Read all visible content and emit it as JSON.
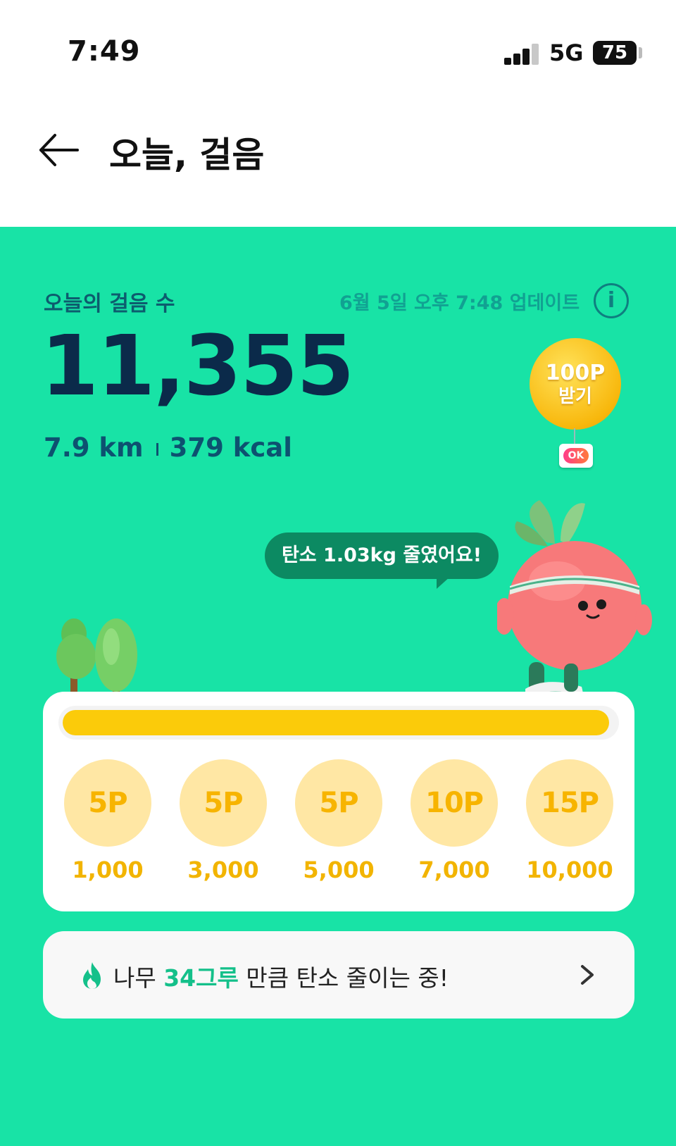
{
  "status_bar": {
    "time": "7:49",
    "network": "5G",
    "battery": "75"
  },
  "header": {
    "title": "오늘, 걸음"
  },
  "steps": {
    "label": "오늘의 걸음 수",
    "updated": "6월 5일 오후 7:48 업데이트",
    "count": "11,355",
    "distance": "7.9 km",
    "calories": "379 kcal"
  },
  "reward": {
    "points": "100P",
    "action": "받기",
    "brand": "OK"
  },
  "speech": {
    "text": "탄소 1.03kg 줄였어요!"
  },
  "progress": {
    "fraction": 0.99,
    "milestones": [
      {
        "points": "5P",
        "steps": "1,000"
      },
      {
        "points": "5P",
        "steps": "3,000"
      },
      {
        "points": "5P",
        "steps": "5,000"
      },
      {
        "points": "10P",
        "steps": "7,000"
      },
      {
        "points": "15P",
        "steps": "10,000"
      }
    ]
  },
  "carbon": {
    "prefix": "나무 ",
    "highlight": "34그루",
    "suffix": " 만큼 탄소 줄이는 중!"
  },
  "colors": {
    "background": "#18e3a6",
    "progress_fill": "#fbcb0a",
    "milestone_badge": "#ffe7a4",
    "milestone_text": "#f2b400",
    "speech_bubble": "#0c8a62",
    "highlight": "#14c08a"
  },
  "icons": {
    "back": "arrow-left-icon",
    "info": "info-icon",
    "flame": "flame-icon",
    "chevron": "chevron-right-icon"
  }
}
